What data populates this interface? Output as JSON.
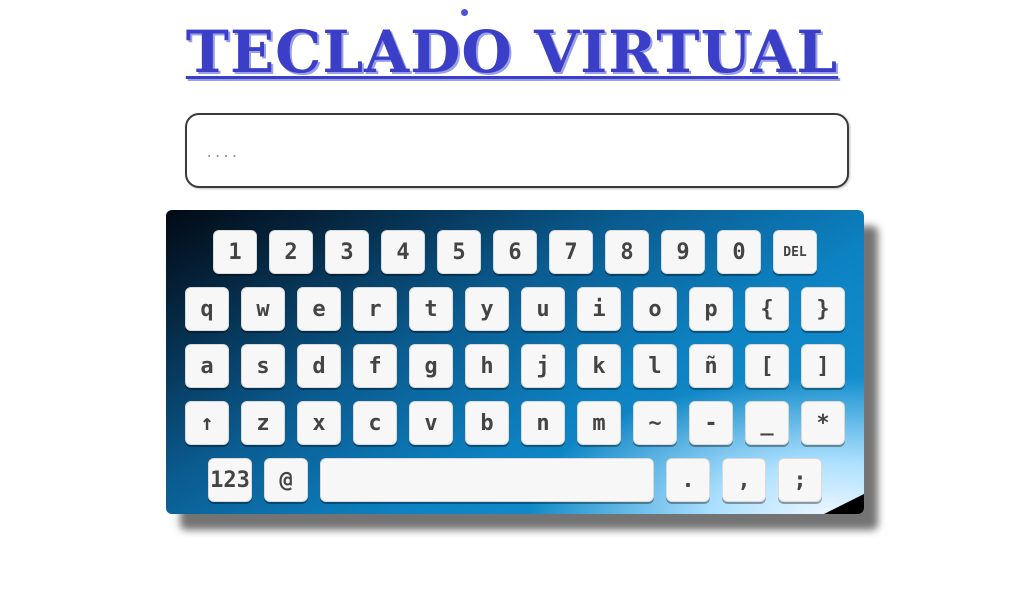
{
  "header": {
    "title": "TECLADO VIRTUAL"
  },
  "input": {
    "placeholder": "....",
    "value": ""
  },
  "keyboard": {
    "rows": [
      [
        "1",
        "2",
        "3",
        "4",
        "5",
        "6",
        "7",
        "8",
        "9",
        "0",
        "DEL"
      ],
      [
        "q",
        "w",
        "e",
        "r",
        "t",
        "y",
        "u",
        "i",
        "o",
        "p",
        "{",
        "}"
      ],
      [
        "a",
        "s",
        "d",
        "f",
        "g",
        "h",
        "j",
        "k",
        "l",
        "ñ",
        "[",
        "]"
      ],
      [
        "↑",
        "z",
        "x",
        "c",
        "v",
        "b",
        "n",
        "m",
        "~",
        "-",
        "_",
        "*"
      ],
      [
        "123",
        "@",
        "",
        ".",
        ",",
        ";"
      ]
    ]
  },
  "colors": {
    "title": "#3b3fc7",
    "keyboard_dark": "#020a14",
    "keyboard_light": "#1a9ad6",
    "key_face": "#f7f7f7"
  }
}
